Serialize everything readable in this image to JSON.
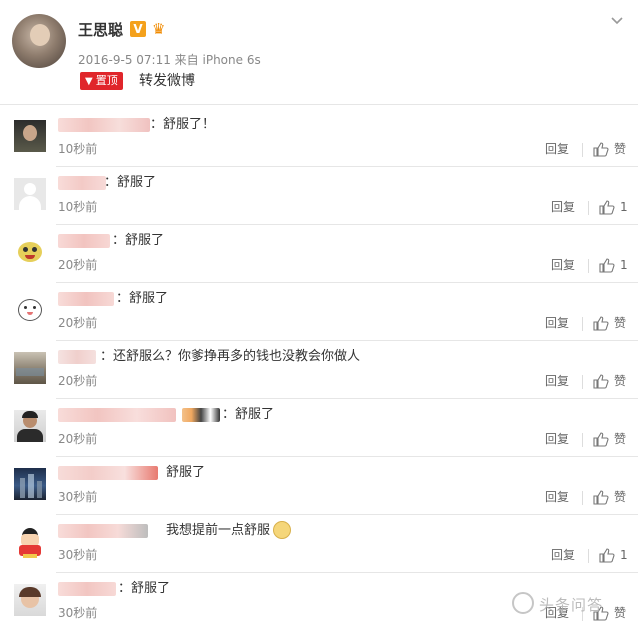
{
  "post": {
    "username": "王思聪",
    "verified_mark": "V",
    "crown_icon": "crown-icon",
    "meta": "2016-9-5 07:11 来自 iPhone 6s",
    "pin_label": "置顶",
    "repost_label": "转发微博"
  },
  "comments": [
    {
      "text": "：舒服了！",
      "time": "10秒前",
      "reply_label": "回复",
      "like_label": "赞"
    },
    {
      "text": "：舒服了",
      "time": "10秒前",
      "reply_label": "回复",
      "like_label": "1"
    },
    {
      "text": "：舒服了",
      "time": "20秒前",
      "reply_label": "回复",
      "like_label": "1"
    },
    {
      "text": "：舒服了",
      "time": "20秒前",
      "reply_label": "回复",
      "like_label": "赞"
    },
    {
      "text": "：还舒服么？你爹挣再多的钱也没教会你做人",
      "time": "20秒前",
      "reply_label": "回复",
      "like_label": "赞"
    },
    {
      "text": "：舒服了",
      "time": "20秒前",
      "reply_label": "回复",
      "like_label": "赞"
    },
    {
      "text": "舒服了",
      "time": "30秒前",
      "reply_label": "回复",
      "like_label": "赞"
    },
    {
      "text": "我想提前一点舒服",
      "time": "30秒前",
      "reply_label": "回复",
      "like_label": "1"
    },
    {
      "text": "：舒服了",
      "time": "30秒前",
      "reply_label": "回复",
      "like_label": "赞"
    }
  ],
  "watermark": "头条问答",
  "colors": {
    "pin_red": "#e0262b",
    "verified_orange": "#f4a11c",
    "blurred_name_pink": "#f6c9c6"
  }
}
